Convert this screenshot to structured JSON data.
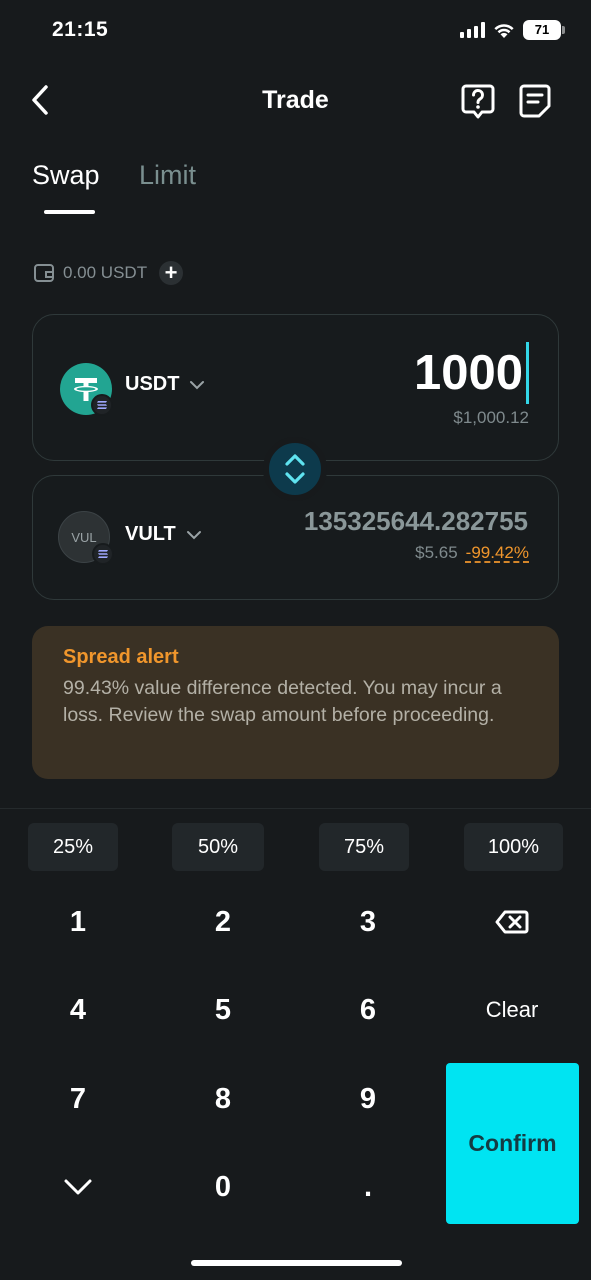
{
  "status_bar": {
    "time": "21:15",
    "battery": "71"
  },
  "header": {
    "title": "Trade"
  },
  "tabs": [
    {
      "label": "Swap",
      "active": true
    },
    {
      "label": "Limit",
      "active": false
    }
  ],
  "balance": {
    "text": "0.00 USDT"
  },
  "from": {
    "token": "USDT",
    "amount": "1000",
    "usd_value": "$1,000.12",
    "icon_color": "#22a592"
  },
  "to": {
    "token": "VULT",
    "icon_text": "VUL",
    "amount": "135325644.282755",
    "usd_value": "$5.65",
    "change": "-99.42%"
  },
  "alert": {
    "title": "Spread alert",
    "body": "99.43% value difference detected. You may incur a loss. Review the swap amount before proceeding."
  },
  "percent_chips": [
    "25%",
    "50%",
    "75%",
    "100%"
  ],
  "keypad": {
    "keys": [
      "1",
      "2",
      "3",
      "4",
      "5",
      "6",
      "7",
      "8",
      "9",
      "0",
      "."
    ],
    "clear": "Clear",
    "confirm": "Confirm"
  },
  "colors": {
    "accent": "#00e4f2",
    "warning": "#f0962c",
    "background": "#171a1c"
  }
}
